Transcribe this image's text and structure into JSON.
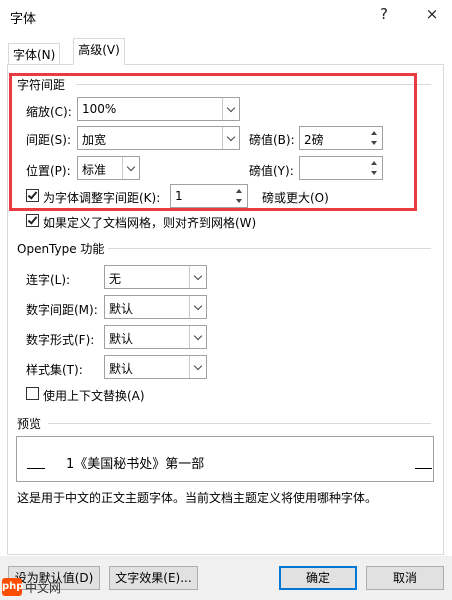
{
  "window": {
    "title": "字体",
    "help_glyph": "?",
    "close_glyph": "×"
  },
  "tabs": [
    {
      "label": "字体(N)"
    },
    {
      "label": "高级(V)"
    }
  ],
  "char_spacing": {
    "group_title": "字符间距",
    "scale_label": "缩放(C):",
    "scale_value": "100%",
    "spacing_label": "间距(S):",
    "spacing_value": "加宽",
    "spacing_pt_label": "磅值(B):",
    "spacing_pt_value": "2磅",
    "position_label": "位置(P):",
    "position_value": "标准",
    "position_pt_label": "磅值(Y):",
    "position_pt_value": "",
    "kerning_checked": true,
    "kerning_label": "为字体调整字间距(K):",
    "kerning_value": "1",
    "kerning_suffix": "磅或更大(O)",
    "grid_checked": true,
    "grid_label": "如果定义了文档网格，则对齐到网格(W)"
  },
  "opentype": {
    "group_title": "OpenType 功能",
    "ligatures_label": "连字(L):",
    "ligatures_value": "无",
    "num_spacing_label": "数字间距(M):",
    "num_spacing_value": "默认",
    "num_forms_label": "数字形式(F):",
    "num_forms_value": "默认",
    "stylistic_label": "样式集(T):",
    "stylistic_value": "默认",
    "contextual_checked": false,
    "contextual_label": "使用上下文替换(A)"
  },
  "preview": {
    "group_title": "预览",
    "sample_text": "1《美国秘书处》第一部",
    "description": "这是用于中文的正文主题字体。当前文档主题定义将使用哪种字体。"
  },
  "buttons": {
    "set_default": "设为默认值(D)",
    "text_effects": "文字效果(E)...",
    "ok": "确定",
    "cancel": "取消"
  },
  "watermark": {
    "logo_text": "php",
    "site_text": "中文网"
  }
}
